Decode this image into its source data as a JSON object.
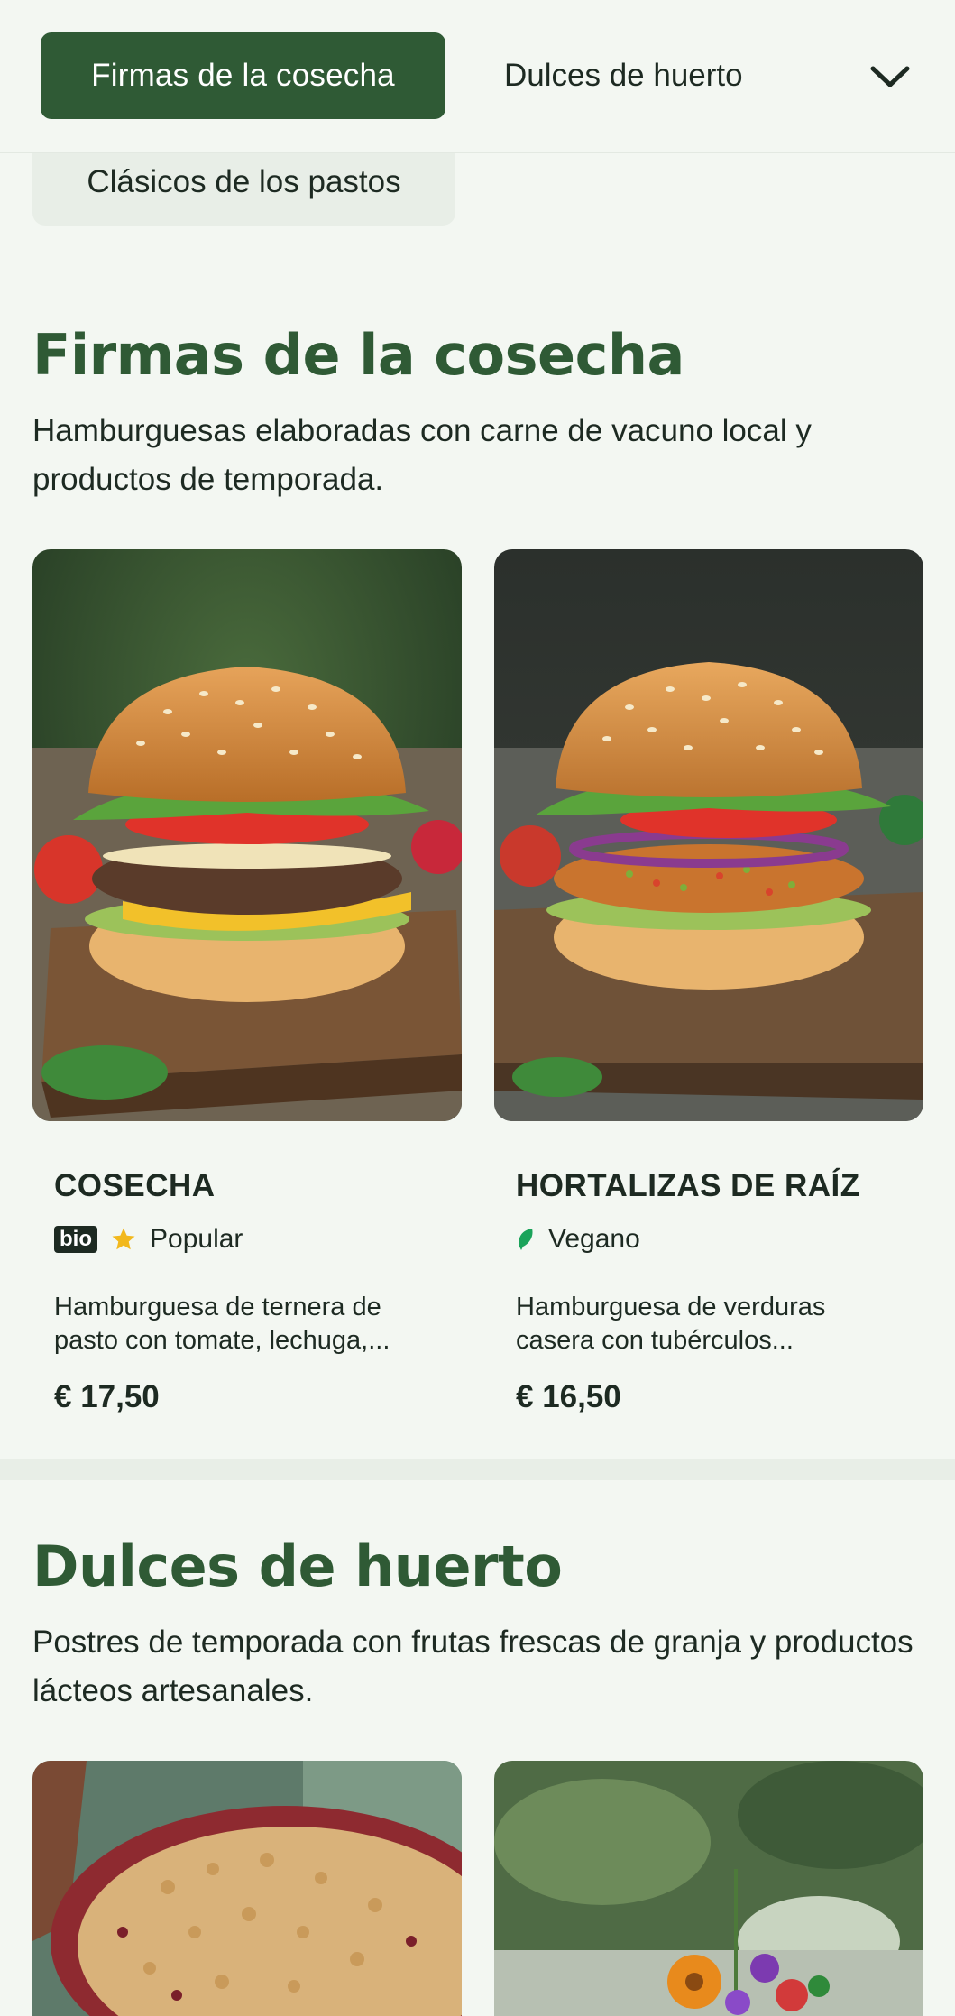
{
  "category_nav": {
    "active_tab": "Firmas de la cosecha",
    "next_tab": "Dulces de huerto",
    "overflow_tab": "Clásicos de los pastos",
    "expand_icon": "chevron-down-icon"
  },
  "sections": [
    {
      "title": "Firmas de la cosecha",
      "description": "Hamburguesas elaboradas con carne de vacuno local y productos de temporada.",
      "items": [
        {
          "name": "COSECHA",
          "badge_bio": "bio",
          "badge_icon": "star-icon",
          "badge_label": "Popular",
          "description": "Hamburguesa de ternera de pasto con tomate, lechuga,...",
          "price": "€ 17,50"
        },
        {
          "name": "HORTALIZAS DE RAÍZ",
          "badge_icon": "leaf-icon",
          "badge_label": "Vegano",
          "description": "Hamburguesa de verduras casera con tubérculos...",
          "price": "€ 16,50"
        }
      ]
    },
    {
      "title": "Dulces de huerto",
      "description": "Postres de temporada con frutas frescas de granja y productos lácteos artesanales."
    }
  ],
  "colors": {
    "brand_green": "#2f5a35",
    "background": "#f3f7f2",
    "star": "#f2b81c",
    "leaf": "#1aa35a"
  }
}
